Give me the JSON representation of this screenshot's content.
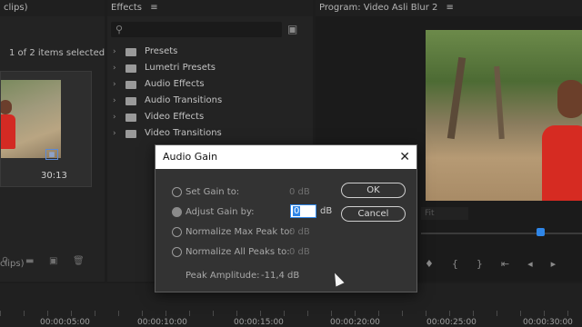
{
  "project_panel": {
    "title_fragment": "clips)",
    "selection_info": "1 of 2 items selected",
    "clip_duration": "30:13",
    "bin_name_fragment": "clips)"
  },
  "effects_panel": {
    "title": "Effects",
    "menu_icon": "hamburger-icon",
    "items": [
      {
        "label": "Presets"
      },
      {
        "label": "Lumetri Presets"
      },
      {
        "label": "Audio Effects"
      },
      {
        "label": "Audio Transitions"
      },
      {
        "label": "Video Effects"
      },
      {
        "label": "Video Transitions"
      }
    ]
  },
  "program_monitor": {
    "title": "Program: Video Asli Blur 2",
    "zoom": "Fit"
  },
  "timeline": {
    "ruler": [
      "00:00:05:00",
      "00:00:10:00",
      "00:00:15:00",
      "00:00:20:00",
      "00:00:25:00",
      "00:00:30:00"
    ]
  },
  "dialog": {
    "title": "Audio Gain",
    "options": [
      {
        "label": "Set Gain to:",
        "value": "0 dB",
        "selected": false
      },
      {
        "label": "Adjust Gain by:",
        "value": "0",
        "unit": "dB",
        "selected": true
      },
      {
        "label": "Normalize Max Peak to:",
        "value": "0 dB",
        "selected": false
      },
      {
        "label": "Normalize All Peaks to:",
        "value": "0 dB",
        "selected": false
      }
    ],
    "peak_label": "Peak Amplitude:",
    "peak_value": "-11,4 dB",
    "ok_label": "OK",
    "cancel_label": "Cancel"
  },
  "colors": {
    "accent": "#2f86e8",
    "dialog_bg": "#333333",
    "panel_bg": "#232323"
  }
}
